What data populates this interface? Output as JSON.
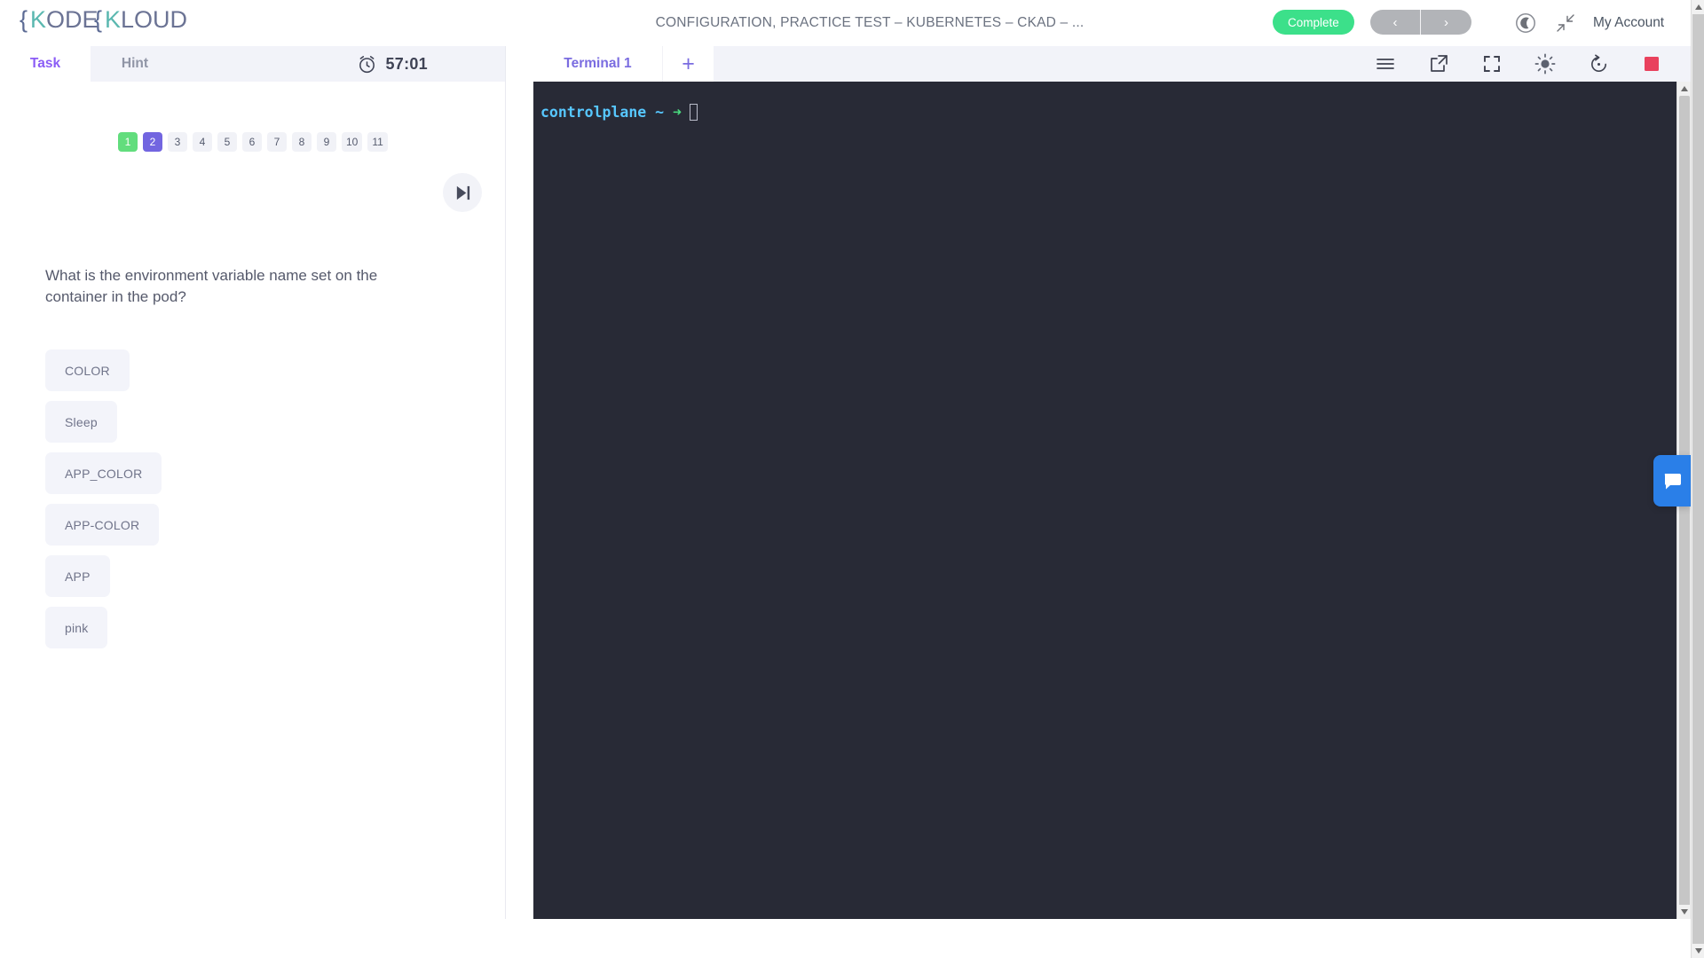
{
  "header": {
    "logo_text": "KODEKLOUD",
    "logo_colors": {
      "brace": "#5c6b94",
      "k": "#5bb8b0",
      "text": "#6b7394"
    },
    "course_title": "CONFIGURATION, PRACTICE TEST – KUBERNETES – CKAD – ...",
    "complete_label": "Complete",
    "complete_color": "#3ce08a",
    "prev_label": "‹",
    "next_label": "›",
    "moon_icon": "dark-mode-moon-icon",
    "collapse_icon": "collapse-arrows-icon",
    "account_label": "My Account"
  },
  "left_panel": {
    "tabs": [
      {
        "label": "Task",
        "active": true
      },
      {
        "label": "Hint",
        "active": false
      }
    ],
    "timer": {
      "icon": "alarm-clock-icon",
      "value": "57:01"
    },
    "question_nav": [
      {
        "label": "1",
        "state": "done"
      },
      {
        "label": "2",
        "state": "current"
      },
      {
        "label": "3",
        "state": "default"
      },
      {
        "label": "4",
        "state": "default"
      },
      {
        "label": "5",
        "state": "default"
      },
      {
        "label": "6",
        "state": "default"
      },
      {
        "label": "7",
        "state": "default"
      },
      {
        "label": "8",
        "state": "default"
      },
      {
        "label": "9",
        "state": "default"
      },
      {
        "label": "10",
        "state": "default"
      },
      {
        "label": "11",
        "state": "default"
      }
    ],
    "skip_icon": "skip-forward-icon",
    "question": "What is the environment variable name set on the container in the pod?",
    "options": [
      {
        "label": "COLOR"
      },
      {
        "label": "Sleep"
      },
      {
        "label": "APP_COLOR"
      },
      {
        "label": "APP-COLOR"
      },
      {
        "label": "APP"
      },
      {
        "label": "pink"
      }
    ]
  },
  "terminal": {
    "tab_label": "Terminal 1",
    "add_label": "+",
    "tools": [
      {
        "name": "menu-icon"
      },
      {
        "name": "external-link-icon"
      },
      {
        "name": "fullscreen-icon"
      },
      {
        "name": "brightness-icon"
      },
      {
        "name": "restart-icon"
      },
      {
        "name": "stop-icon"
      }
    ],
    "prompt_host": "controlplane",
    "prompt_path": "~",
    "prompt_arrow": "➜",
    "background": "#282a36",
    "host_color": "#57c7ff",
    "arrow_color": "#4ade80"
  },
  "chat": {
    "icon": "chat-bubble-icon",
    "color": "#2a7fe8"
  }
}
